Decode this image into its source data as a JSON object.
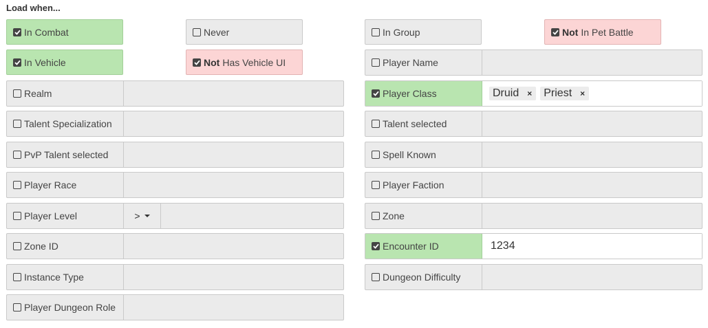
{
  "heading": "Load when...",
  "not_label": "Not",
  "toggles": {
    "in_combat": "In Combat",
    "never": "Never",
    "in_group": "In Group",
    "in_pet_battle": "In Pet Battle",
    "in_vehicle": "In Vehicle",
    "has_vehicle_ui": "Has Vehicle UI"
  },
  "fields": {
    "player_name": "Player Name",
    "realm": "Realm",
    "player_class": "Player Class",
    "talent_specialization": "Talent Specialization",
    "talent_selected": "Talent selected",
    "pvp_talent_selected": "PvP Talent selected",
    "spell_known": "Spell Known",
    "player_race": "Player Race",
    "player_faction": "Player Faction",
    "player_level": "Player Level",
    "zone": "Zone",
    "zone_id": "Zone ID",
    "encounter_id": "Encounter ID",
    "instance_type": "Instance Type",
    "dungeon_difficulty": "Dungeon Difficulty",
    "player_dungeon_role": "Player Dungeon Role"
  },
  "player_class_values": [
    "Druid",
    "Priest"
  ],
  "tag_remove": "×",
  "player_level_operator": ">",
  "encounter_id_value": "1234",
  "colors": {
    "active": "#b9e5b0",
    "negated": "#fcd5d5",
    "inactive": "#ebebeb"
  }
}
